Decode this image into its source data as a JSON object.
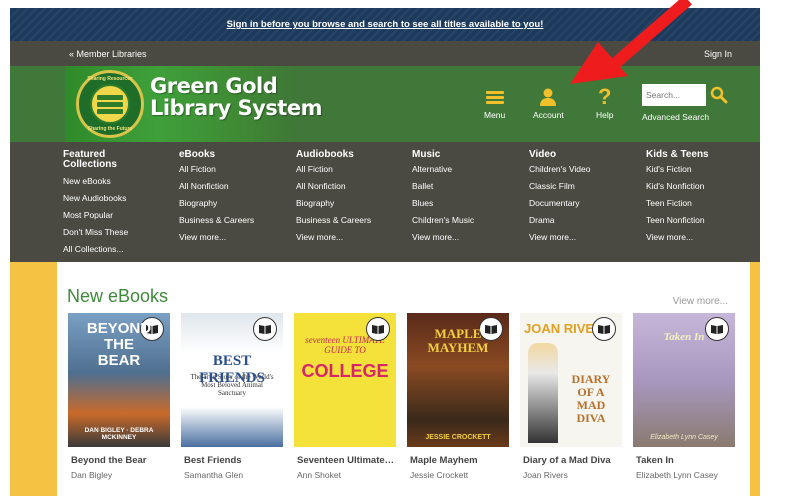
{
  "banner": {
    "sign_in_text": "Sign in before you browse and search to see all titles available to you!"
  },
  "nav": {
    "member_libraries": "« Member Libraries",
    "sign_in": "Sign In"
  },
  "brand": {
    "line1": "Green Gold",
    "line2": "Library System",
    "seal_top": "Sharing Resources",
    "seal_bottom": "Sharing the Future"
  },
  "header_buttons": {
    "menu": "Menu",
    "account": "Account",
    "help": "Help"
  },
  "search": {
    "placeholder": "Search...",
    "advanced": "Advanced Search"
  },
  "menu_columns": [
    {
      "title": "Featured Collections",
      "links": [
        "New eBooks",
        "New Audiobooks",
        "Most Popular",
        "Don't Miss These",
        "All Collections..."
      ]
    },
    {
      "title": "eBooks",
      "links": [
        "All Fiction",
        "All Nonfiction",
        "Biography",
        "Business & Careers",
        "View more..."
      ]
    },
    {
      "title": "Audiobooks",
      "links": [
        "All Fiction",
        "All Nonfiction",
        "Biography",
        "Business & Careers",
        "View more..."
      ]
    },
    {
      "title": "Music",
      "links": [
        "Alternative",
        "Ballet",
        "Blues",
        "Children's Music",
        "View more..."
      ]
    },
    {
      "title": "Video",
      "links": [
        "Children's Video",
        "Classic Film",
        "Documentary",
        "Drama",
        "View more..."
      ]
    },
    {
      "title": "Kids & Teens",
      "links": [
        "Kid's Fiction",
        "Kid's Nonfiction",
        "Teen Fiction",
        "Teen Nonfiction",
        "View more..."
      ]
    }
  ],
  "section": {
    "title": "New eBooks",
    "view_more": "View more..."
  },
  "books": [
    {
      "title": "Beyond the Bear",
      "author": "Dan Bigley",
      "cover_text": "BEYOND THE BEAR",
      "cover_sub": "DAN BIGLEY · DEBRA MCKINNEY",
      "bg": "#5b7fa3"
    },
    {
      "title": "Best Friends",
      "author": "Samantha Glen",
      "cover_text": "BEST FRIENDS",
      "cover_sub": "The True Story of the World's Most Beloved Animal Sanctuary",
      "bg": "#e9eef2"
    },
    {
      "title": "Seventeen Ultimate Guide to College",
      "author": "Ann Shoket",
      "cover_text": "COLLEGE",
      "cover_sub": "seventeen ULTIMATE GUIDE TO",
      "bg": "#f4e23a"
    },
    {
      "title": "Maple Mayhem",
      "author": "Jessie Crockett",
      "cover_text": "MAPLE MAYHEM",
      "cover_sub": "JESSIE CROCKETT",
      "bg": "#7a3a1e"
    },
    {
      "title": "Diary of a Mad Diva",
      "author": "Joan Rivers",
      "cover_text": "DIARY OF A MAD DIVA",
      "cover_sub": "JOAN RIVERS",
      "bg": "#f3f1ec"
    },
    {
      "title": "Taken In",
      "author": "Elizabeth Lynn Casey",
      "cover_text": "Taken In",
      "cover_sub": "Elizabeth Lynn Casey",
      "bg": "#b9a8cc"
    }
  ]
}
